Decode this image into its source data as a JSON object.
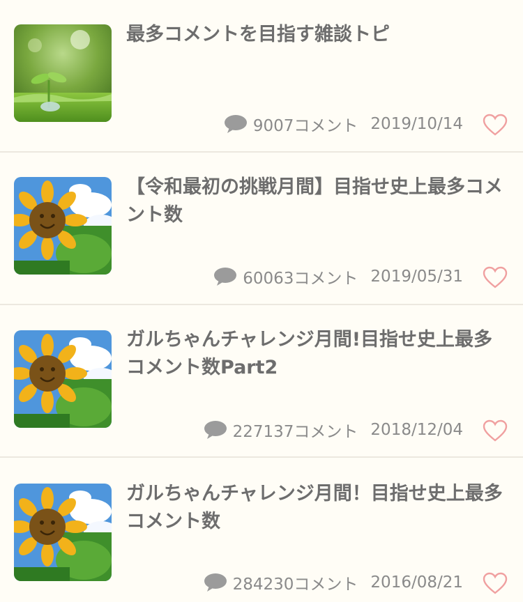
{
  "topics": [
    {
      "thumb_icon": "sprout-photo-icon",
      "title": "最多コメントを目指す雑談トピ",
      "comments": "9007コメント",
      "date": "2019/10/14"
    },
    {
      "thumb_icon": "sunflower-photo-icon",
      "title": "【令和最初の挑戦月間】目指せ史上最多コメント数",
      "comments": "60063コメント",
      "date": "2019/05/31"
    },
    {
      "thumb_icon": "sunflower-photo-icon",
      "title": "ガルちゃんチャレンジ月間!目指せ史上最多コメント数Part2",
      "comments": "227137コメント",
      "date": "2018/12/04"
    },
    {
      "thumb_icon": "sunflower-photo-icon",
      "title": "ガルちゃんチャレンジ月間！目指せ史上最多コメント数",
      "comments": "284230コメント",
      "date": "2016/08/21"
    }
  ],
  "icons": {
    "comment": "speech-bubble-icon",
    "favorite": "heart-outline-icon"
  },
  "colors": {
    "background": "#fffdf6",
    "title_text": "#6d6d6d",
    "meta_text": "#8a8a8a",
    "bubble": "#9b9b9b",
    "heart": "#f0a0a0",
    "divider": "#ece8df"
  }
}
